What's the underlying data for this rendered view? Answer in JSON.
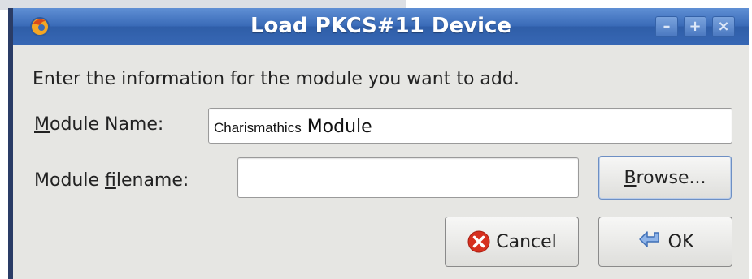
{
  "window": {
    "title": "Load PKCS#11 Device",
    "titlebar_color": "#3a6bb8",
    "buttons": {
      "minimize_icon": "minimize-icon",
      "maximize_icon": "maximize-icon",
      "close_icon": "close-icon"
    }
  },
  "dialog": {
    "prompt": "Enter the information for the module you want to add.",
    "module_name": {
      "label_mnemonic": "M",
      "label_rest": "odule Name:",
      "value_prefix": "Charismathics",
      "value_suffix": " Module"
    },
    "module_filename": {
      "label_start": "Module ",
      "label_mnemonic": "f",
      "label_rest": "ilename:",
      "value": ""
    },
    "browse_button": {
      "mnemonic": "B",
      "rest": "rowse..."
    },
    "cancel_button": {
      "label": "Cancel",
      "icon": "cancel-icon",
      "icon_color": "#d6301f"
    },
    "ok_button": {
      "label": "OK",
      "icon": "ok-arrow-icon",
      "icon_color": "#4a7fc9"
    }
  }
}
